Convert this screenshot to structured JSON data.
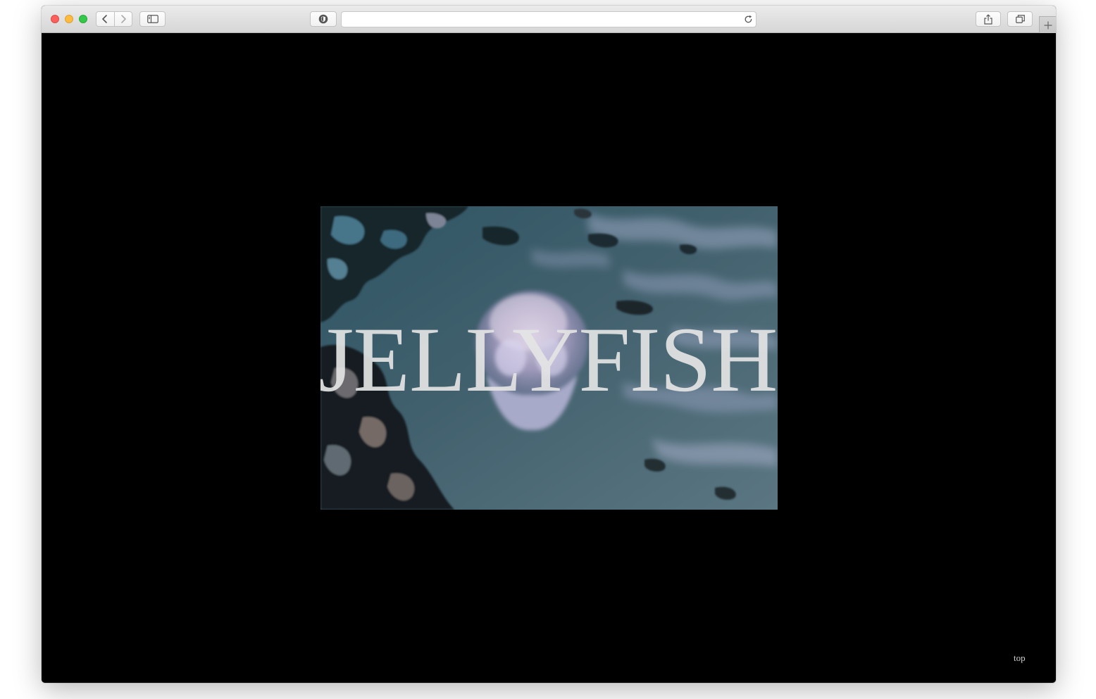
{
  "browser": {
    "address_text": "",
    "icons": {
      "back": "chevron-left-icon",
      "forward": "chevron-right-icon",
      "sidebar": "sidebar-icon",
      "privacy": "shield-icon",
      "reload": "reload-icon",
      "share": "share-icon",
      "tabs": "tabs-overview-icon",
      "new_tab": "plus-icon"
    }
  },
  "page": {
    "background_color": "#000000",
    "hero": {
      "title": "JELLYFISH",
      "image": "jellyfish-in-water-photo"
    },
    "top_link": "top"
  }
}
